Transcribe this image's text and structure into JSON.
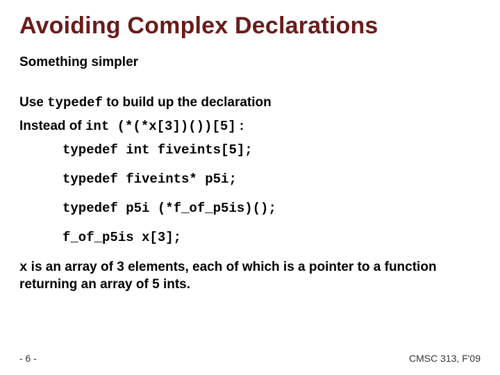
{
  "title": "Avoiding Complex Declarations",
  "subtitle": "Something simpler",
  "use_line": {
    "pre": "Use ",
    "kw": "typedef",
    "post": " to build up the declaration"
  },
  "instead_line": {
    "pre": "Instead of ",
    "code": "int (*(*x[3])())[5]",
    "post": " :"
  },
  "codelines": [
    "typedef int fiveints[5];",
    "typedef fiveints* p5i;",
    "typedef p5i (*f_of_p5is)();",
    "f_of_p5is x[3];"
  ],
  "explain": {
    "var": "x",
    "rest": " is an array of 3 elements, each of which is a pointer to a function returning an array of 5 ints."
  },
  "footer": {
    "page": "- 6 -",
    "course": "CMSC 313, F'09"
  }
}
